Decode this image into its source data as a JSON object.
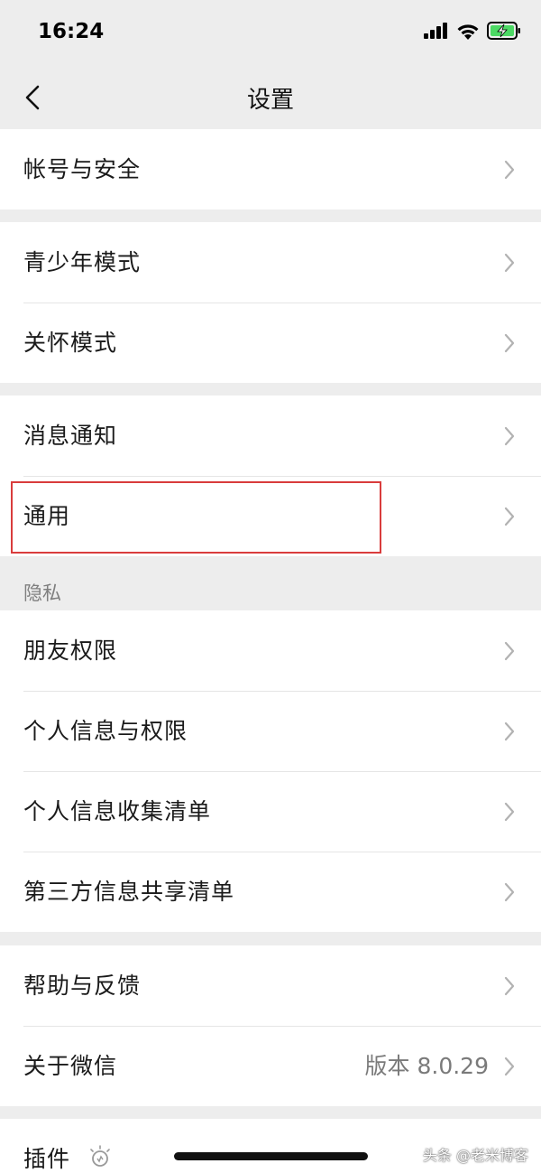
{
  "status_bar": {
    "time": "16:24"
  },
  "nav": {
    "title": "设置"
  },
  "groups": [
    {
      "rows": [
        {
          "label": "帐号与安全"
        }
      ]
    },
    {
      "rows": [
        {
          "label": "青少年模式"
        },
        {
          "label": "关怀模式"
        }
      ]
    },
    {
      "rows": [
        {
          "label": "消息通知"
        },
        {
          "label": "通用"
        }
      ]
    },
    {
      "header": "隐私",
      "rows": [
        {
          "label": "朋友权限"
        },
        {
          "label": "个人信息与权限"
        },
        {
          "label": "个人信息收集清单"
        },
        {
          "label": "第三方信息共享清单"
        }
      ]
    },
    {
      "rows": [
        {
          "label": "帮助与反馈"
        },
        {
          "label": "关于微信",
          "value": "版本 8.0.29"
        }
      ]
    },
    {
      "rows": [
        {
          "label": "插件"
        }
      ]
    }
  ],
  "watermark": "头条 @老米博客",
  "colors": {
    "background": "#ededed",
    "card": "#ffffff",
    "highlight": "#d93c3c"
  },
  "icons": [
    "signal-icon",
    "wifi-icon",
    "battery-charging-icon",
    "back-chevron-icon",
    "chevron-right-icon",
    "plugin-bulb-icon"
  ]
}
